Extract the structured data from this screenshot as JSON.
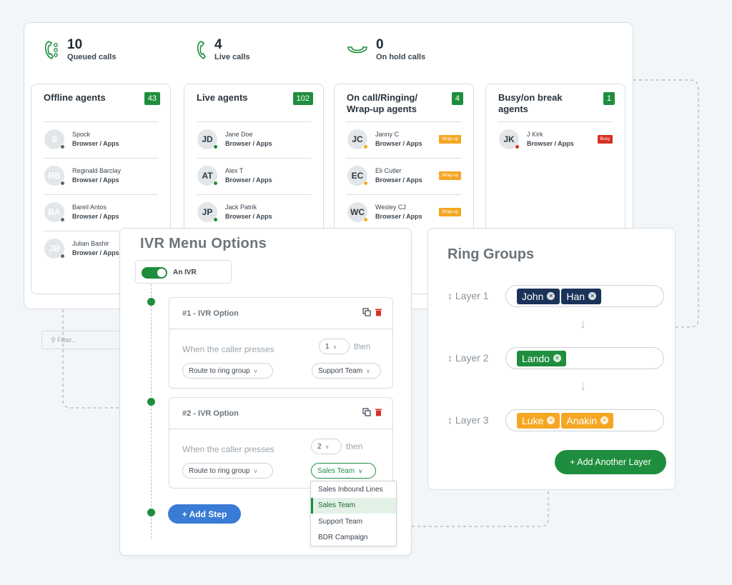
{
  "stats": [
    {
      "icon": "queued-calls-icon",
      "number": "10",
      "label": "Queued calls"
    },
    {
      "icon": "phone-icon",
      "number": "4",
      "label": "Live calls"
    },
    {
      "icon": "on-hold-icon",
      "number": "0",
      "label": "On hold calls"
    }
  ],
  "columns": [
    {
      "title": "Offline agents",
      "count": "43",
      "agents": [
        {
          "initials": "S",
          "name": "Spock",
          "sub": "Browser / Apps"
        },
        {
          "initials": "RB",
          "name": "Reginald Barclay",
          "sub": "Browser / Apps"
        },
        {
          "initials": "BA",
          "name": "Bareil Antos",
          "sub": "Browser / Apps"
        },
        {
          "initials": "JB",
          "name": "Julian Bashir",
          "sub": "Browser / Apps"
        }
      ],
      "filter_placeholder": "Filter..."
    },
    {
      "title": "Live agents",
      "count": "102",
      "agents": [
        {
          "initials": "JD",
          "name": "Jane Doe",
          "sub": "Browser / Apps"
        },
        {
          "initials": "AT",
          "name": "Alex T",
          "sub": "Browser / Apps"
        },
        {
          "initials": "JP",
          "name": "Jack Patrik",
          "sub": "Browser / Apps"
        }
      ]
    },
    {
      "title": "On call/Ringing/ Wrap-up agents",
      "count": "4",
      "agents": [
        {
          "initials": "JC",
          "name": "Janny C",
          "sub": "Browser / Apps",
          "tag": "Wrap-up"
        },
        {
          "initials": "EC",
          "name": "Eli Cutler",
          "sub": "Browser / Apps",
          "tag": "Wrap-up"
        },
        {
          "initials": "WC",
          "name": "Wesley CJ",
          "sub": "Browser / Apps",
          "tag": "Wrap-up"
        }
      ],
      "partial_text": "pps"
    },
    {
      "title": "Busy/on break agents",
      "count": "1",
      "agents": [
        {
          "initials": "JK",
          "name": "J Kirk",
          "sub": "Browser / Apps",
          "tag": "Busy"
        }
      ]
    }
  ],
  "colors": {
    "green": "#1e8e3e",
    "orange": "#f5a623",
    "red": "#d93025",
    "gray_dot": "#5f6368",
    "blue": "#3a7bd5",
    "navy": "#1b3358"
  },
  "ivr": {
    "title": "IVR Menu Options",
    "toggle_label": "An IVR",
    "toggle_on": true,
    "options": [
      {
        "title": "#1 - IVR Option",
        "prompt": "When the caller presses",
        "key": "1",
        "then": "then",
        "action": "Route to ring group",
        "target": "Support Team"
      },
      {
        "title": "#2 - IVR Option",
        "prompt": "When the caller presses",
        "key": "2",
        "then": "then",
        "action": "Route to ring group",
        "target": "Sales Team"
      }
    ],
    "dropdown": [
      "Sales Inbound Lines",
      "Sales Team",
      "Support Team",
      "BDR Campaign"
    ],
    "dropdown_selected": "Sales Team",
    "add_step": "+ Add Step"
  },
  "ring": {
    "title": "Ring Groups",
    "layers": [
      {
        "label": "Layer 1",
        "members": [
          "John",
          "Han"
        ],
        "color": "navy"
      },
      {
        "label": "Layer 2",
        "members": [
          "Lando"
        ],
        "color": "green"
      },
      {
        "label": "Layer 3",
        "members": [
          "Luke",
          "Anakin"
        ],
        "color": "orange"
      }
    ],
    "add_layer": "+ Add Another Layer"
  }
}
